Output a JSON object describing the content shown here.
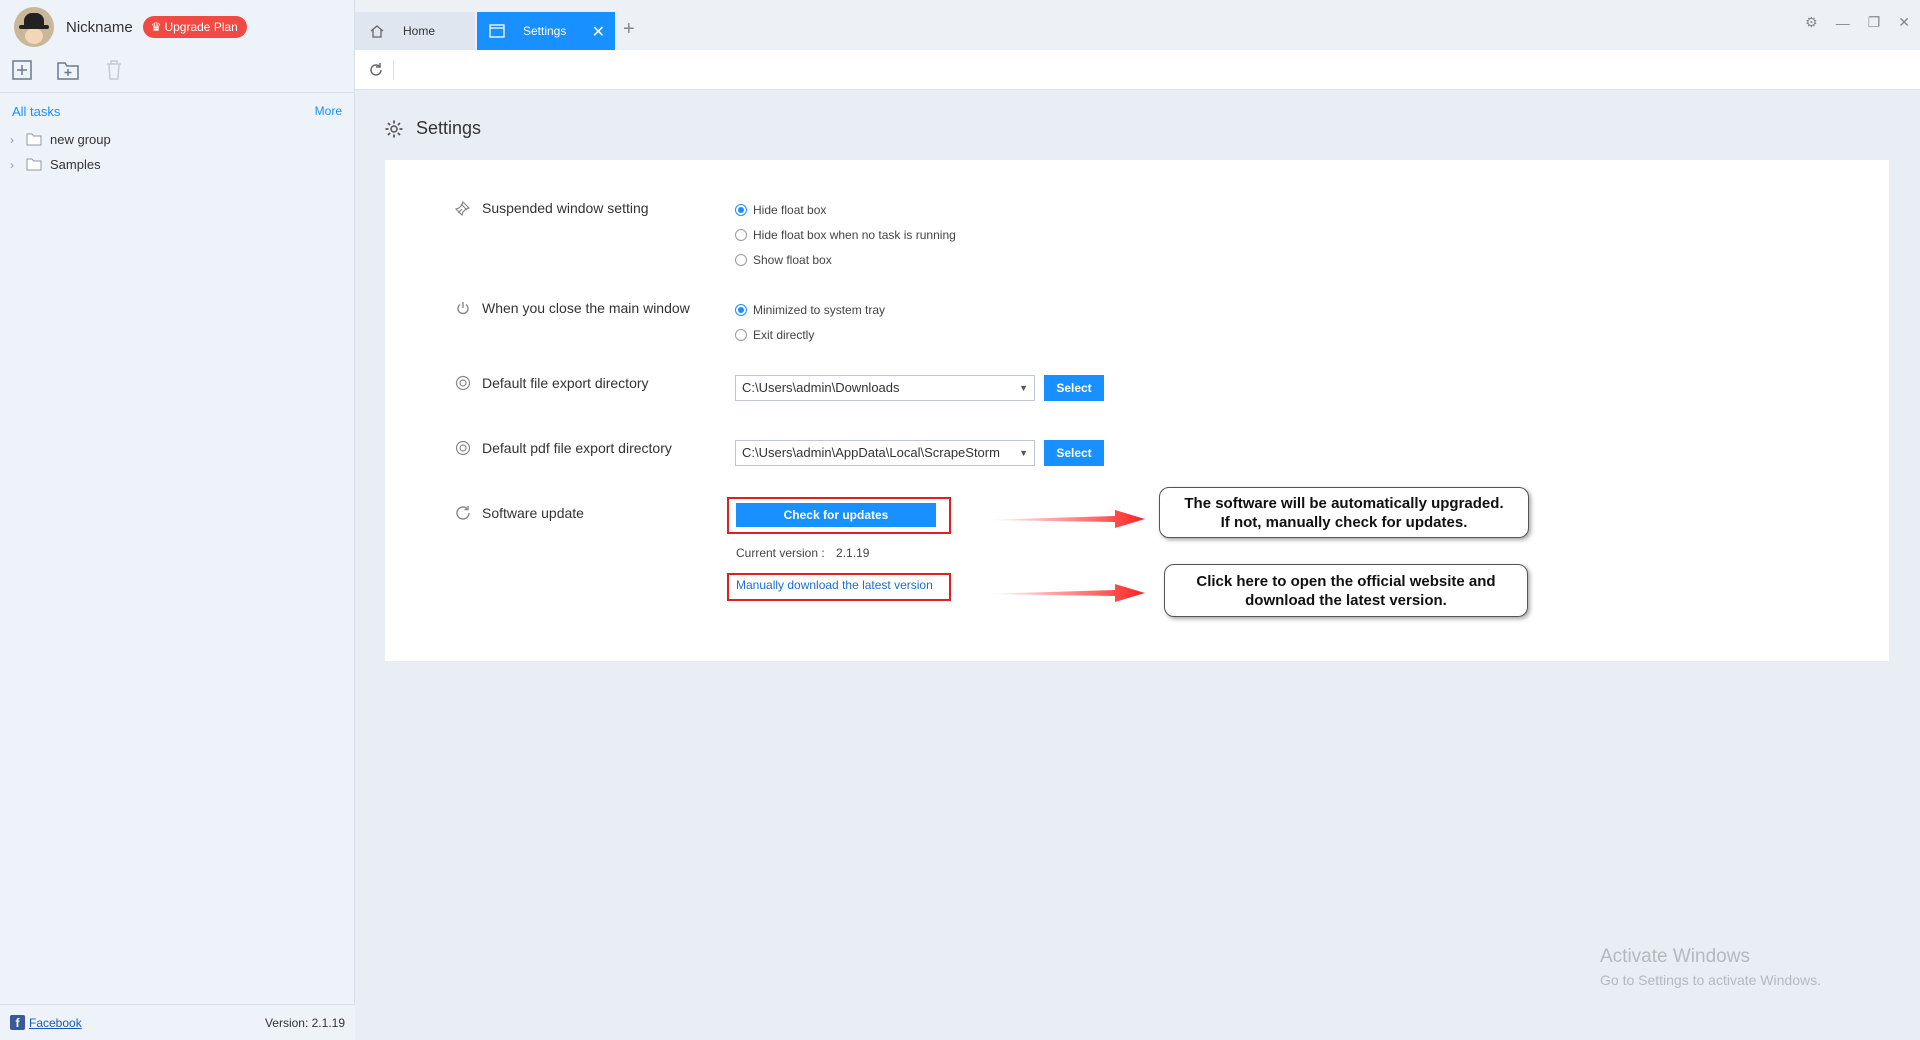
{
  "user": {
    "nickname": "Nickname",
    "upgrade_label": "Upgrade Plan"
  },
  "sidebar": {
    "all_tasks": "All tasks",
    "more": "More",
    "groups": [
      {
        "label": "new group"
      },
      {
        "label": "Samples"
      }
    ],
    "footer": {
      "facebook": "Facebook",
      "version": "Version: 2.1.19"
    }
  },
  "tabs": [
    {
      "label": "Home"
    },
    {
      "label": "Settings",
      "active": true
    }
  ],
  "page": {
    "title": "Settings"
  },
  "settings": {
    "suspended": {
      "label": "Suspended window setting",
      "options": [
        "Hide float box",
        "Hide float box when no task is running",
        "Show float box"
      ],
      "selected": 0
    },
    "close_main": {
      "label": "When you close the main window",
      "options": [
        "Minimized to system tray",
        "Exit directly"
      ],
      "selected": 0
    },
    "export_dir": {
      "label": "Default file export directory",
      "value": "C:\\Users\\admin\\Downloads",
      "button": "Select"
    },
    "pdf_dir": {
      "label": "Default pdf file export directory",
      "value": "C:\\Users\\admin\\AppData\\Local\\ScrapeStorm",
      "button": "Select"
    },
    "update": {
      "label": "Software update",
      "check_button": "Check for updates",
      "current_version_label": "Current version :",
      "current_version": "2.1.19",
      "download_link": "Manually download the latest version"
    }
  },
  "callouts": {
    "auto_upgrade": [
      "The software will be automatically upgraded.",
      "If not, manually check for updates."
    ],
    "official_site": [
      "Click here to open the official website and",
      "download the latest version."
    ]
  },
  "watermark": {
    "title": "Activate Windows",
    "subtitle": "Go to Settings to activate Windows."
  },
  "colors": {
    "accent": "#1890ff",
    "upgrade": "#f04a42",
    "annotation": "#e02020"
  }
}
